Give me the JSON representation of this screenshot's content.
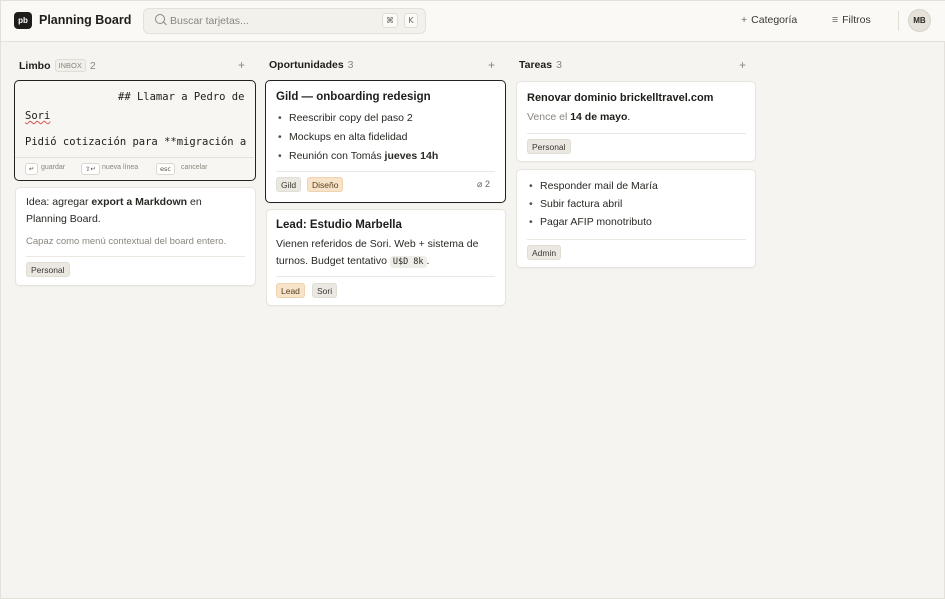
{
  "app": {
    "logo_text": "pb",
    "title": "Planning Board"
  },
  "search": {
    "placeholder": "Buscar tarjetas...",
    "shortcut_mod": "⌘",
    "shortcut_key": "K"
  },
  "header": {
    "category_label": "Categoría",
    "category_icon": "+",
    "filters_label": "Filtros",
    "filters_icon": "≡",
    "avatar": "MB"
  },
  "columns": [
    {
      "title": "Limbo",
      "badge": "INBOX",
      "count": "2",
      "add": "+"
    },
    {
      "title": "Oportunidades",
      "count": "3",
      "add": "+"
    },
    {
      "title": "Tareas",
      "count": "3",
      "add": "+"
    }
  ],
  "editor": {
    "line1": "## Llamar a Pedro de",
    "line2": "Sori",
    "line3": "Pidió cotización para **migración a",
    "hints": [
      {
        "key": "↵",
        "label": "guardar"
      },
      {
        "key": "⇧↵",
        "label": "nueva línea"
      },
      {
        "key": "esc",
        "label": "cancelar"
      }
    ]
  },
  "limbo_card": {
    "text_a": "Idea: agregar ",
    "text_bold": "export a Markdown",
    "text_b": " en",
    "text_c": "Planning Board.",
    "note": "Capaz como menú contextual del board entero.",
    "tag": "Personal"
  },
  "opp_card1": {
    "title": "Gild — onboarding redesign",
    "items": [
      "Reescribir copy del paso 2",
      "Mockups en alta fidelidad"
    ],
    "item3_a": "Reunión con Tomás ",
    "item3_bold": "jueves 14h",
    "tags": [
      "Gild",
      "Diseño"
    ],
    "attachments": "2"
  },
  "opp_card2": {
    "title": "Lead: Estudio Marbella",
    "text_line1": "Vienen referidos de Sori. Web + sistema de",
    "text_line2": "turnos. Budget tentativo ",
    "code": "U$D 8k",
    "text_end": ".",
    "tags": [
      "Lead",
      "Sori"
    ]
  },
  "task_card1": {
    "title": "Renovar dominio brickelltravel.com",
    "text_a": "Vence el ",
    "text_bold": "14 de mayo",
    "text_end": ".",
    "tag": "Personal"
  },
  "task_card2": {
    "items": [
      "Responder mail de María",
      "Subir factura abril",
      "Pagar AFIP monotributo"
    ],
    "tag": "Admin"
  }
}
